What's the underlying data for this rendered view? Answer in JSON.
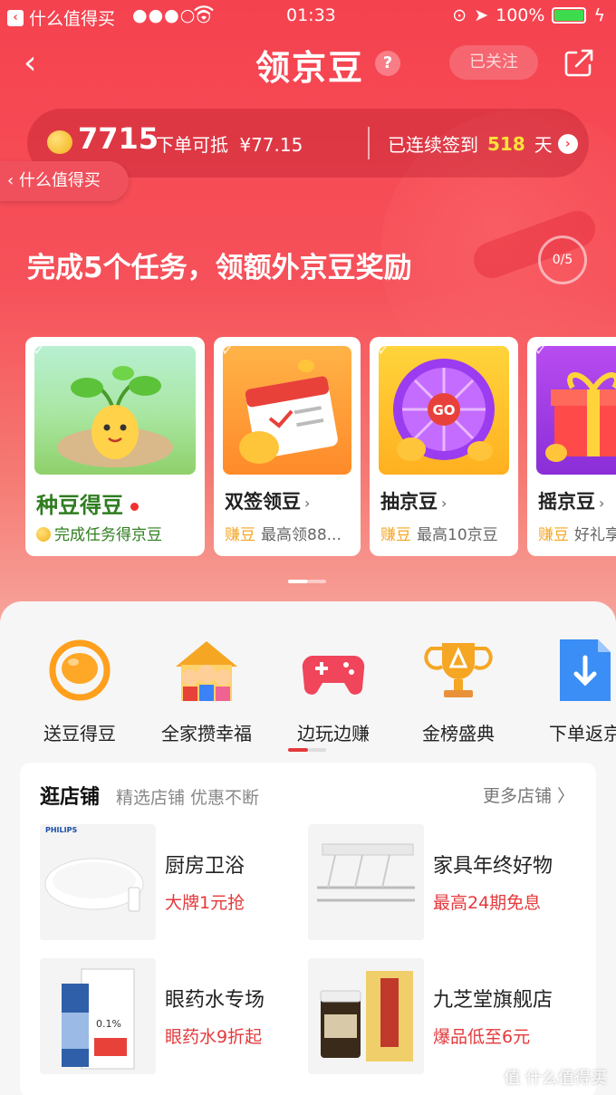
{
  "status_bar": {
    "back_app": "什么值得买",
    "signal": "●●●○○",
    "time": "01:33",
    "battery": "100%"
  },
  "nav": {
    "back_icon": "‹",
    "title": "领京豆",
    "help": "?",
    "follow": "已关注"
  },
  "beans": {
    "count": "7715",
    "deduct_label": "下单可抵",
    "deduct_value": "¥77.15",
    "checkin_label": "已连续签到",
    "checkin_days": "518",
    "checkin_unit": "天"
  },
  "return_app": "什么值得买",
  "task": {
    "title": "完成5个任务，领额外京豆奖励",
    "progress": "0/5"
  },
  "cards": [
    {
      "name": "种豆得豆",
      "desc": "完成任务得京豆"
    },
    {
      "name": "双签领豆",
      "tag": "赚豆",
      "desc": "最高领88..."
    },
    {
      "name": "抽京豆",
      "tag": "赚豆",
      "desc": "最高10京豆"
    },
    {
      "name": "摇京豆",
      "tag": "赚豆",
      "desc": "好礼享"
    }
  ],
  "icons": [
    {
      "label": "送豆得豆"
    },
    {
      "label": "全家攒幸福"
    },
    {
      "label": "边玩边赚"
    },
    {
      "label": "金榜盛典"
    },
    {
      "label": "下单返京"
    }
  ],
  "shop": {
    "title": "逛店铺",
    "subtitle": "精选店铺 优惠不断",
    "more": "更多店铺 〉",
    "tiles": [
      {
        "title": "厨房卫浴",
        "promo": "大牌1元抢",
        "logo": "PHILIPS"
      },
      {
        "title": "家具年终好物",
        "promo": "最高24期免息"
      },
      {
        "title": "眼药水专场",
        "promo": "眼药水9折起",
        "label": "0.1%"
      },
      {
        "title": "九芝堂旗舰店",
        "promo": "爆品低至6元"
      }
    ]
  },
  "watermark": "值 什么值得买",
  "colors": {
    "brand": "#f5424f",
    "accent_red": "#e4393c",
    "gold": "#ffe13a"
  }
}
